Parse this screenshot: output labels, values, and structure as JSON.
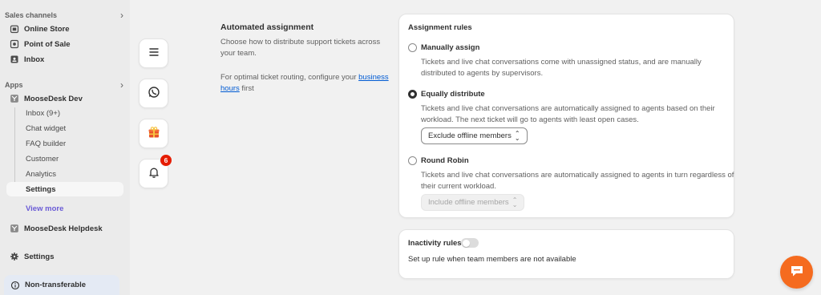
{
  "sidebar": {
    "sales_channels_label": "Sales channels",
    "channels": [
      {
        "label": "Online Store",
        "icon": "store-icon"
      },
      {
        "label": "Point of Sale",
        "icon": "pos-icon"
      },
      {
        "label": "Inbox",
        "icon": "inbox-icon"
      }
    ],
    "apps_label": "Apps",
    "app_name": "MooseDesk Dev",
    "app_sub_items": [
      "Inbox (9+)",
      "Chat widget",
      "FAQ builder",
      "Customer",
      "Analytics",
      "Settings"
    ],
    "view_more": "View more",
    "app2_name": "MooseDesk Helpdesk",
    "settings_label": "Settings",
    "non_transferable": "Non-transferable"
  },
  "float_icons": {
    "menu": "menu-icon",
    "whatsapp": "whatsapp-icon",
    "gift": "gift-icon",
    "bell": "bell-icon",
    "bell_badge": "6"
  },
  "section": {
    "title": "Automated assignment",
    "description": "Choose how to distribute support tickets across your team.",
    "routing_prefix": "For optimal ticket routing, configure your ",
    "routing_link": "business hours",
    "routing_suffix": " first"
  },
  "assignment_card": {
    "title": "Assignment rules",
    "options": [
      {
        "label": "Manually assign",
        "description": "Tickets and live chat conversations come with unassigned status, and are manually distributed to agents by supervisors.",
        "selected": false
      },
      {
        "label": "Equally distribute",
        "description": "Tickets and live chat conversations are automatically assigned to agents based on their workload. The next ticket will go to agents with least open cases.",
        "selected": true,
        "select_value": "Exclude offline members"
      },
      {
        "label": "Round Robin",
        "description": "Tickets and live chat conversations are automatically assigned to agents in turn regardless of their current workload.",
        "selected": false,
        "select_value": "Include offline members"
      }
    ]
  },
  "inactivity_card": {
    "title": "Inactivity rules",
    "toggle_on": false,
    "description": "Set up rule when team members are not available"
  },
  "colors": {
    "accent_link": "#005bd3",
    "view_more": "#6a5bd6",
    "badge": "#e51c00",
    "chat_fab": "#f56b1f"
  }
}
